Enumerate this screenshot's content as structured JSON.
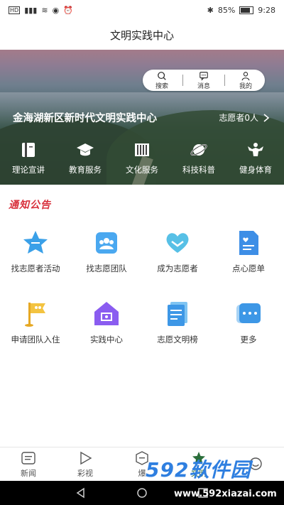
{
  "status": {
    "left_icons": "HD 4G signal wifi eye alarm",
    "battery": "85%",
    "time": "9:28"
  },
  "title": "文明实践中心",
  "hero": {
    "toolbar": [
      {
        "label": "搜索",
        "icon": "search-icon"
      },
      {
        "label": "消息",
        "icon": "message-icon"
      },
      {
        "label": "我的",
        "icon": "user-icon"
      }
    ],
    "center_name": "金海湖新区新时代文明实践中心",
    "volunteer_count": "志愿者0人",
    "categories": [
      {
        "label": "理论宣讲",
        "icon": "book-icon"
      },
      {
        "label": "教育服务",
        "icon": "graduation-cap-icon"
      },
      {
        "label": "文化服务",
        "icon": "culture-icon"
      },
      {
        "label": "科技科普",
        "icon": "planet-icon"
      },
      {
        "label": "健身体育",
        "icon": "fitness-icon"
      }
    ]
  },
  "notice_title": "通知公告",
  "features": [
    {
      "label": "找志愿者活动",
      "icon": "star-icon"
    },
    {
      "label": "找志愿团队",
      "icon": "team-icon"
    },
    {
      "label": "成为志愿者",
      "icon": "heart-icon"
    },
    {
      "label": "点心愿单",
      "icon": "wish-list-icon"
    },
    {
      "label": "申请团队入住",
      "icon": "flag-icon"
    },
    {
      "label": "实践中心",
      "icon": "house-icon"
    },
    {
      "label": "志愿文明榜",
      "icon": "ranking-icon"
    },
    {
      "label": "更多",
      "icon": "more-icon"
    }
  ],
  "bottom_nav": [
    {
      "label": "新闻",
      "icon": "news-icon"
    },
    {
      "label": "彩视",
      "icon": "play-icon"
    },
    {
      "label": "爆",
      "icon": "burst-icon"
    },
    {
      "label": "文明",
      "icon": "civilization-icon"
    },
    {
      "label": "",
      "icon": "profile-icon"
    }
  ],
  "watermark": {
    "brand": "592软件园",
    "url": "www.592xiazai.com"
  },
  "colors": {
    "accent": "#2f7fe0",
    "notice": "#d8303c",
    "active": "#2a6e3a"
  }
}
